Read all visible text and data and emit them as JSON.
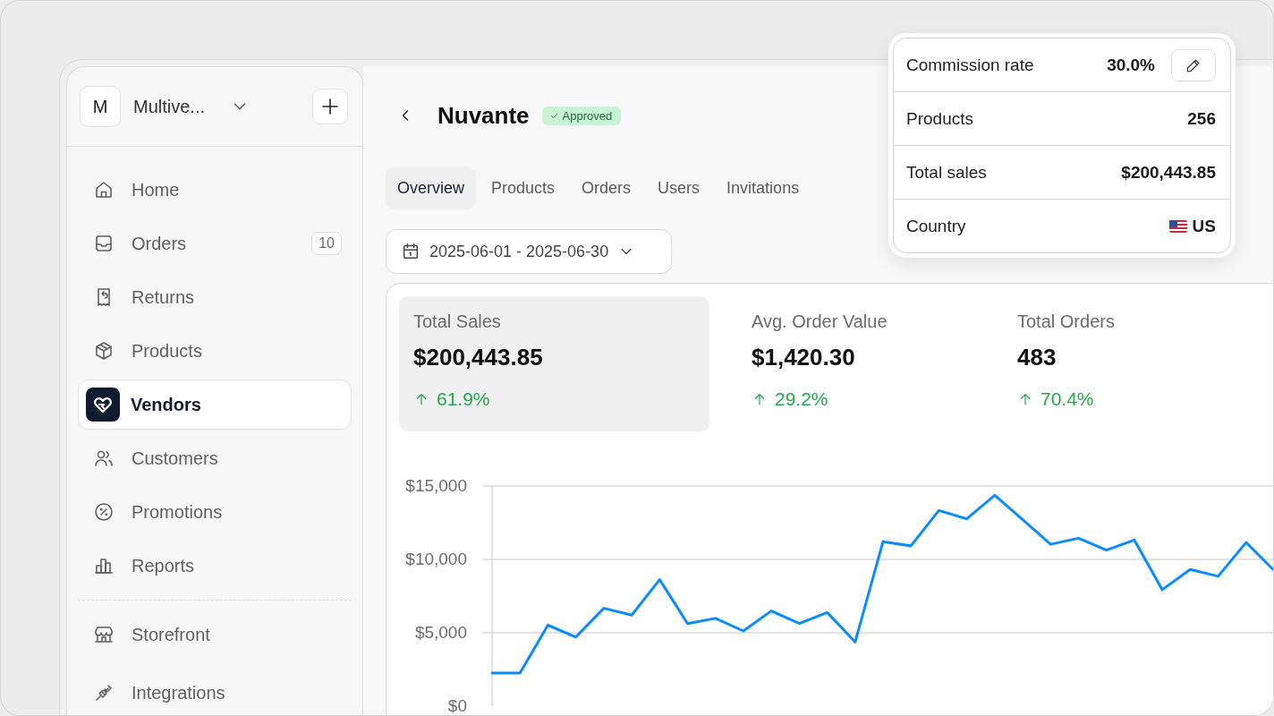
{
  "workspace": {
    "initial": "M",
    "name": "Multive..."
  },
  "sidebar": {
    "items": [
      {
        "label": "Home",
        "kind": "home",
        "selected": false
      },
      {
        "label": "Orders",
        "kind": "inbox",
        "badge": "10",
        "selected": false
      },
      {
        "label": "Returns",
        "kind": "receipt",
        "selected": false
      },
      {
        "label": "Products",
        "kind": "box",
        "selected": false
      },
      {
        "label": "Vendors",
        "kind": "vendor",
        "selected": true
      },
      {
        "label": "Customers",
        "kind": "users",
        "selected": false
      },
      {
        "label": "Promotions",
        "kind": "percent",
        "selected": false
      },
      {
        "label": "Reports",
        "kind": "chart",
        "selected": false
      }
    ],
    "secondary_items": [
      {
        "label": "Storefront",
        "kind": "store",
        "selected": false
      },
      {
        "label": "Integrations",
        "kind": "plug",
        "selected": false
      }
    ]
  },
  "vendor": {
    "name": "Nuvante",
    "status": "Approved"
  },
  "tabs": [
    {
      "label": "Overview",
      "selected": true
    },
    {
      "label": "Products",
      "selected": false
    },
    {
      "label": "Orders",
      "selected": false
    },
    {
      "label": "Users",
      "selected": false
    },
    {
      "label": "Invitations",
      "selected": false
    }
  ],
  "date_range": "2025-06-01 - 2025-06-30",
  "stats": [
    {
      "label": "Total Sales",
      "value": "$200,443.85",
      "change": "61.9%",
      "selected": true
    },
    {
      "label": "Avg. Order Value",
      "value": "$1,420.30",
      "change": "29.2%",
      "selected": false
    },
    {
      "label": "Total Orders",
      "value": "483",
      "change": "70.4%",
      "selected": false
    }
  ],
  "chart_data": {
    "type": "line",
    "ylim": [
      0,
      15000
    ],
    "yticks": [
      {
        "value": 0,
        "label": "$0"
      },
      {
        "value": 5000,
        "label": "$5,000"
      },
      {
        "value": 10000,
        "label": "$10,000"
      },
      {
        "value": 15000,
        "label": "$15,000"
      }
    ],
    "values": [
      2250,
      2250,
      5520,
      4710,
      6670,
      6210,
      8620,
      5630,
      5980,
      5120,
      6490,
      5630,
      6380,
      4370,
      11210,
      10920,
      13330,
      12760,
      14370,
      12700,
      11030,
      11440,
      10630,
      11320,
      7930,
      9310,
      8850,
      11150,
      9250
    ]
  },
  "details": [
    {
      "kind": "rate",
      "label": "Commission rate",
      "value": "30.0%"
    },
    {
      "kind": "plain",
      "label": "Products",
      "value": "256"
    },
    {
      "kind": "plain",
      "label": "Total sales",
      "value": "$200,443.85"
    },
    {
      "kind": "country",
      "label": "Country",
      "value": "US"
    }
  ]
}
